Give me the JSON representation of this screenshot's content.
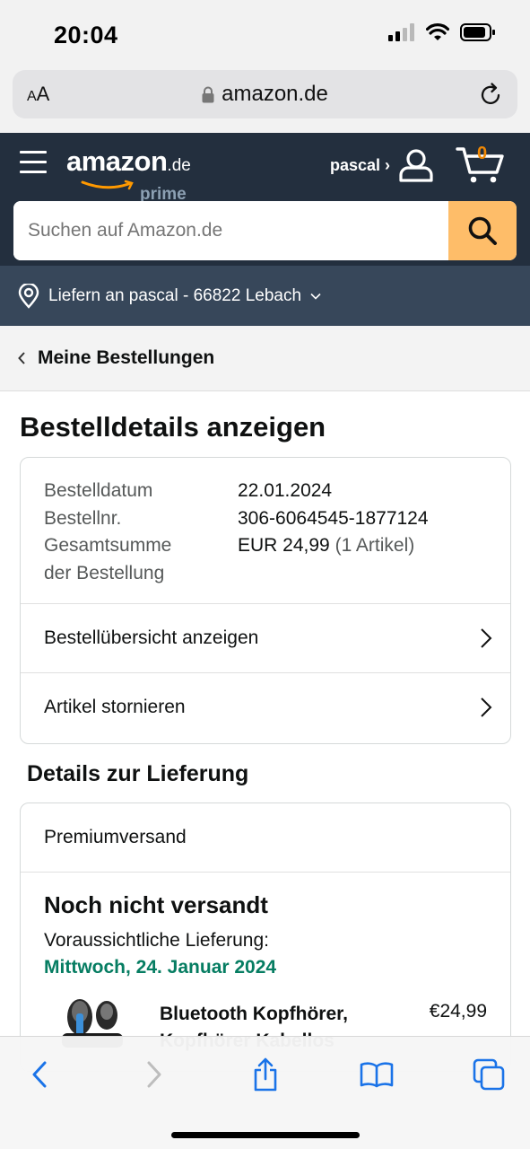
{
  "status_bar": {
    "time": "20:04"
  },
  "browser": {
    "aa_small": "A",
    "aa_big": "A",
    "host": "amazon.de"
  },
  "header": {
    "logo_text": "amazon",
    "logo_tld": ".de",
    "logo_sub": "prime",
    "account_label": "pascal ›",
    "cart_count": "0",
    "search_placeholder": "Suchen auf Amazon.de",
    "deliver_to": "Liefern an pascal - 66822 Lebach",
    "colors": {
      "nav": "#232f3e",
      "subnav": "#37475a",
      "search_button": "#febd69",
      "cart_count": "#f08804"
    }
  },
  "breadcrumb": {
    "label": "Meine Bestellungen"
  },
  "page": {
    "title": "Bestelldetails anzeigen"
  },
  "order_summary": {
    "rows": [
      {
        "label": "Bestelldatum",
        "value": "22.01.2024",
        "extra": ""
      },
      {
        "label": "Bestellnr.",
        "value": "306-6064545-1877124",
        "extra": ""
      },
      {
        "label": "Gesamtsumme",
        "value": "EUR 24,99",
        "extra": "(1 Artikel)"
      },
      {
        "label": "der Bestellung",
        "value": "",
        "extra": ""
      }
    ],
    "actions": [
      {
        "label": "Bestellübersicht anzeigen"
      },
      {
        "label": "Artikel stornieren"
      }
    ]
  },
  "delivery": {
    "section_title": "Details zur Lieferung",
    "shipping_method": "Premiumversand",
    "status": "Noch nicht versandt",
    "eta_label": "Voraussichtliche Lieferung:",
    "eta_date": "Mittwoch, 24. Januar 2024",
    "eta_color": "#067d62",
    "product": {
      "title_line1": "Bluetooth Kopfhörer,",
      "title_line2": "Kopfhörer Kabellos",
      "price": "€24,99"
    }
  }
}
